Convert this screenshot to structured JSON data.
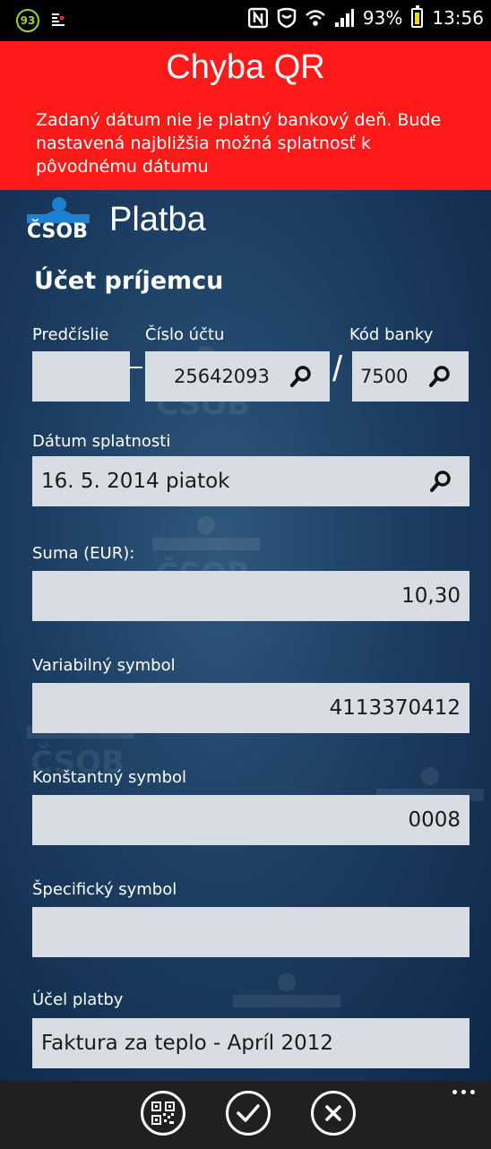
{
  "status_bar": {
    "left_badge": "93",
    "battery_percent": "93%",
    "time": "13:56"
  },
  "error": {
    "title": "Chyba QR",
    "message": "Zadaný dátum nie je platný bankový deň. Bude nastavená najbližšia možná splatnosť k pôvodnému dátumu"
  },
  "header": {
    "logo_text": "ČSOB",
    "title": "Platba"
  },
  "form": {
    "section_title": "Účet príjemcu",
    "prefix_label": "Predčíslie",
    "prefix_value": "",
    "account_label": "Číslo účtu",
    "account_value": "25642093",
    "bank_code_label": "Kód banky",
    "bank_code_value": "7500",
    "due_date_label": "Dátum splatnosti",
    "due_date_value": "16. 5. 2014 piatok",
    "amount_label": "Suma (EUR):",
    "amount_value": "10,30",
    "variable_symbol_label": "Variabilný symbol",
    "variable_symbol_value": "4113370412",
    "constant_symbol_label": "Konštantný symbol",
    "constant_symbol_value": "0008",
    "specific_symbol_label": "Špecifický symbol",
    "specific_symbol_value": "",
    "purpose_label": "Účel platby",
    "purpose_value": "Faktura za teplo - Apríl 2012"
  },
  "app_bar": {
    "icons": [
      "qr-code-icon",
      "checkmark-icon",
      "close-icon",
      "more-icon"
    ]
  },
  "colors": {
    "error_bg": "#ff1a1a",
    "field_bg": "#d8dde3",
    "app_bar_bg": "#202020",
    "csob_blue": "#1f7fd1"
  }
}
